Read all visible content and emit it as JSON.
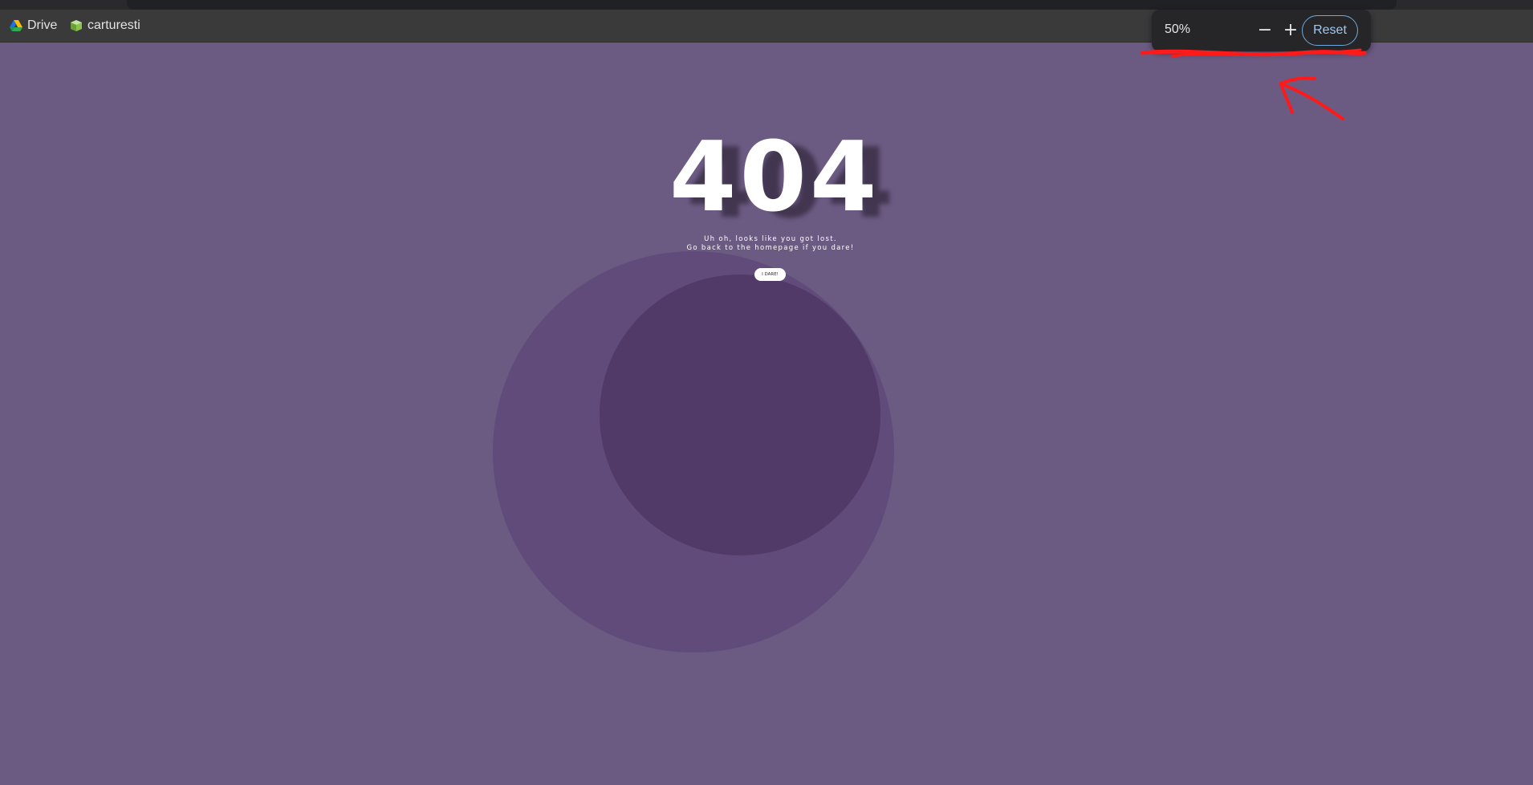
{
  "colors": {
    "page_bg": "#6b5a82",
    "circle_outer": "#604b7b",
    "circle_inner": "#523a68",
    "annotation": "#ff1a1a",
    "reset_accent": "#6fa8dc"
  },
  "bookmarks": [
    {
      "label": "Drive",
      "icon": "google-drive-icon"
    },
    {
      "label": "carturesti",
      "icon": "carturesti-icon"
    }
  ],
  "zoom": {
    "level": "50%",
    "decrease_label": "−",
    "increase_label": "+",
    "reset_label": "Reset"
  },
  "page": {
    "error_code": "404",
    "line1": "Uh oh, looks like you got lost.",
    "line2": "Go back to the homepage if you dare!",
    "button_label": "I DARE!"
  }
}
